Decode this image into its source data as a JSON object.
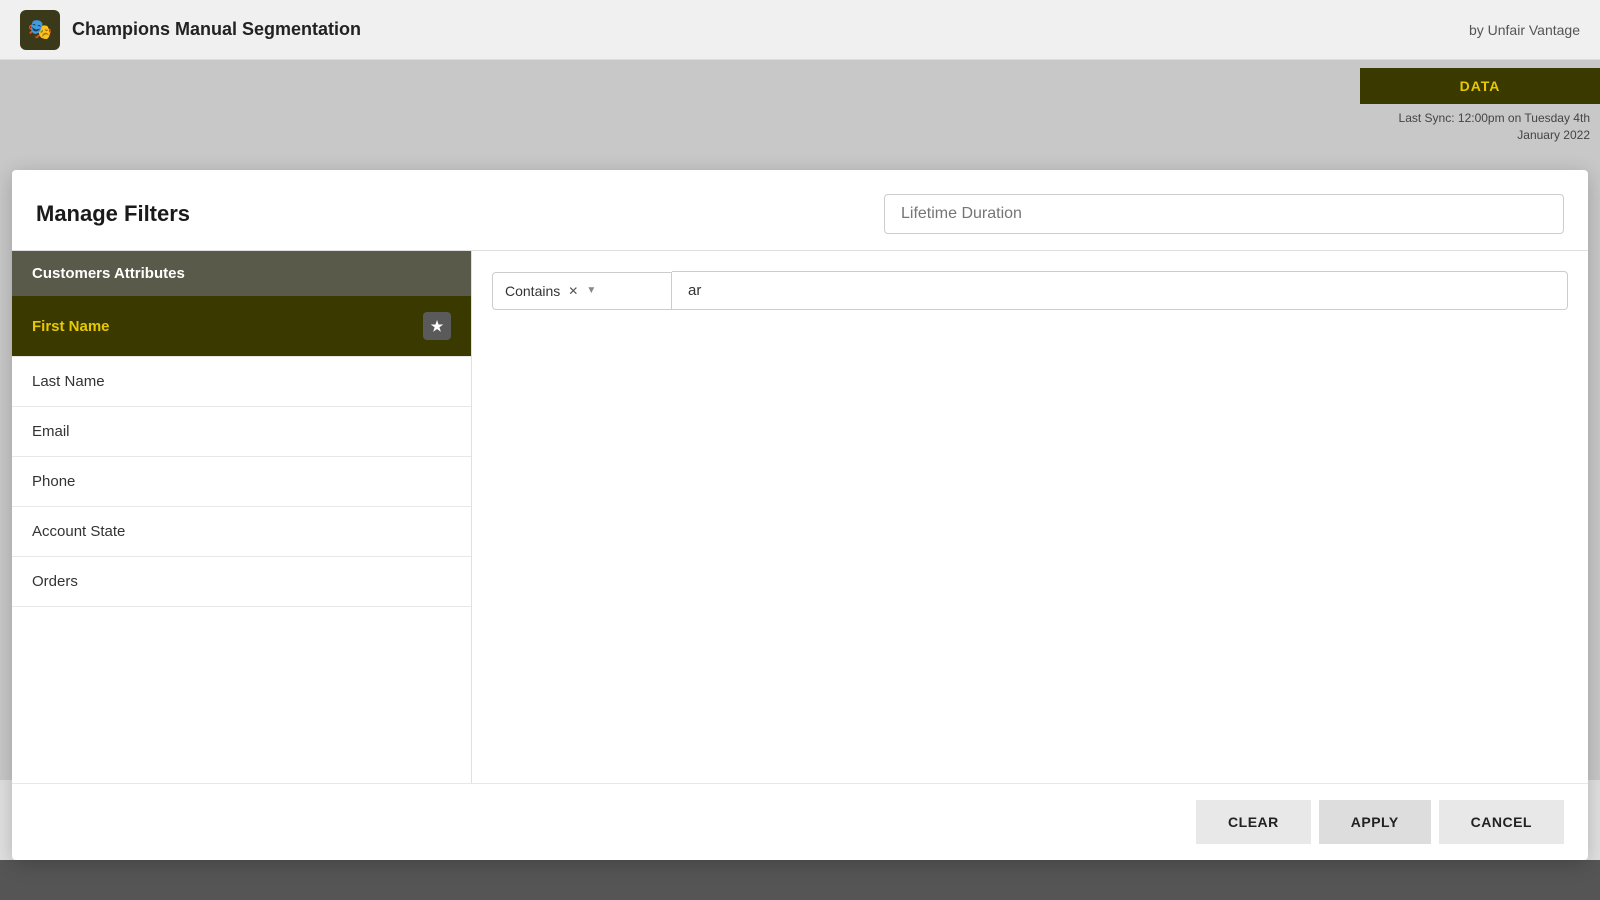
{
  "app": {
    "logo_emoji": "🎭",
    "title": "Champions Manual Segmentation",
    "byline": "by Unfair Vantage"
  },
  "data_button": {
    "label": "DATA",
    "last_sync_label": "Last Sync: 12:00pm on Tuesday 4th January 2022"
  },
  "modal": {
    "title": "Manage Filters",
    "filter_name_placeholder": "Lifetime Duration",
    "filter_name_value": ""
  },
  "sidebar": {
    "category_label": "Customers Attributes",
    "items": [
      {
        "id": "first-name",
        "label": "First Name",
        "active": true,
        "starred": true
      },
      {
        "id": "last-name",
        "label": "Last Name",
        "active": false,
        "starred": false
      },
      {
        "id": "email",
        "label": "Email",
        "active": false,
        "starred": false
      },
      {
        "id": "phone",
        "label": "Phone",
        "active": false,
        "starred": false
      },
      {
        "id": "account-state",
        "label": "Account State",
        "active": false,
        "starred": false
      },
      {
        "id": "orders",
        "label": "Orders",
        "active": false,
        "starred": false
      }
    ]
  },
  "filter_condition": {
    "operator": "Contains",
    "value": "ar"
  },
  "footer": {
    "clear_label": "CLEAR",
    "apply_label": "APPLY",
    "cancel_label": "CANCEL"
  }
}
